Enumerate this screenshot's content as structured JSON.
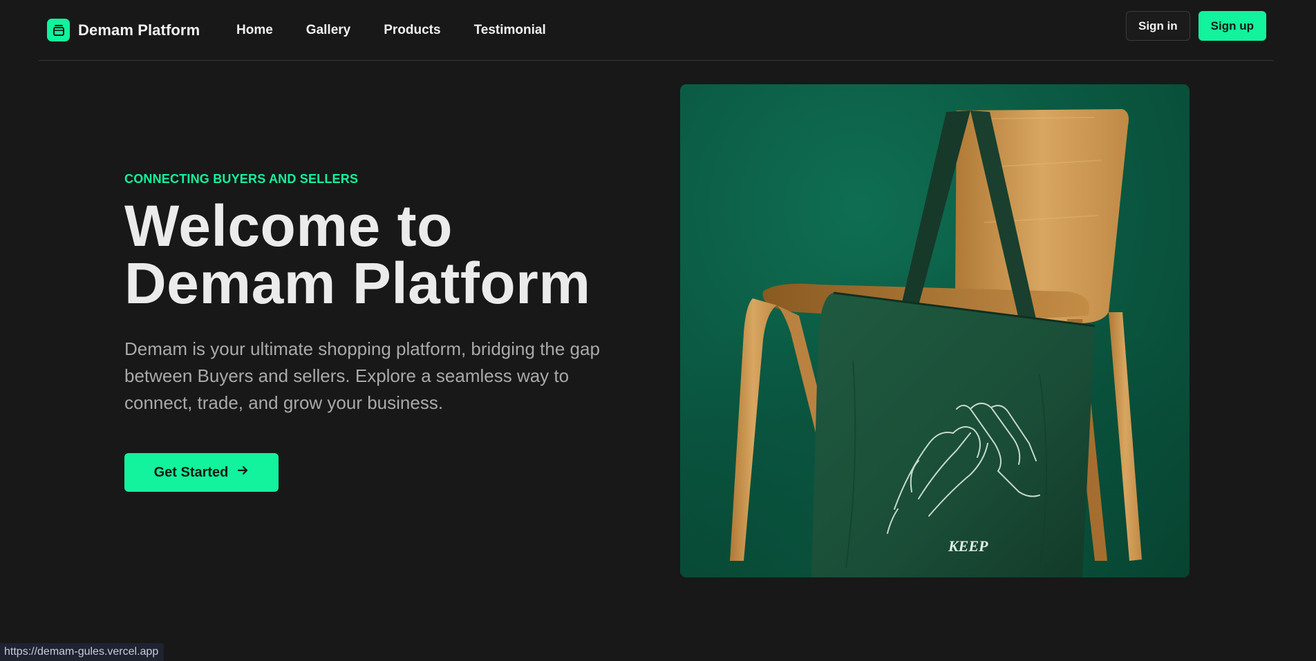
{
  "brand": {
    "name": "Demam Platform",
    "logo_icon": "box-icon",
    "accent_color": "#13f29c"
  },
  "nav": {
    "items": [
      {
        "label": "Home"
      },
      {
        "label": "Gallery"
      },
      {
        "label": "Products"
      },
      {
        "label": "Testimonial"
      }
    ]
  },
  "auth": {
    "signin_label": "Sign in",
    "signup_label": "Sign up"
  },
  "hero": {
    "eyebrow": "CONNECTING BUYERS AND SELLERS",
    "title_line1": "Welcome to",
    "title_line2": "Demam Platform",
    "description": "Demam is your ultimate shopping platform, bridging the gap between Buyers and sellers. Explore a seamless way to connect, trade, and grow your business.",
    "cta_label": "Get Started",
    "cta_icon": "arrow-right-icon",
    "image": {
      "subject": "tote-bag-on-wooden-chair",
      "bag_print_text": "KEEP"
    }
  },
  "status_bar": {
    "url": "https://demam-gules.vercel.app"
  }
}
